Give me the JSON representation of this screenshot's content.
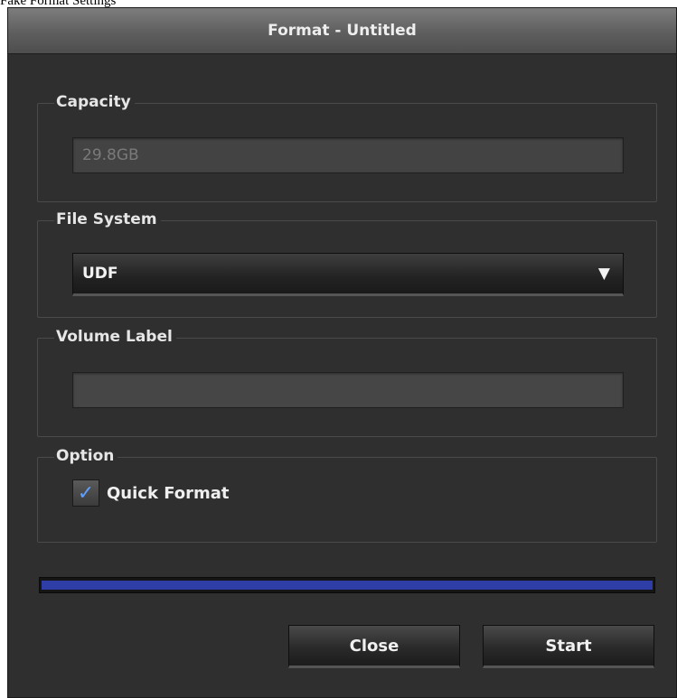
{
  "caption": "Fake Format Settings",
  "window": {
    "title": "Format - Untitled"
  },
  "capacity": {
    "legend": "Capacity",
    "value": "29.8GB"
  },
  "file_system": {
    "legend": "File System",
    "selected": "UDF",
    "arrow_icon": "▼"
  },
  "volume_label": {
    "legend": "Volume Label",
    "value": ""
  },
  "option": {
    "legend": "Option",
    "quick_format_label": "Quick Format",
    "quick_format_checked": true,
    "check_glyph": "✓"
  },
  "progress": {
    "fraction": 1.0,
    "color": "#2f3ea6"
  },
  "buttons": {
    "close": "Close",
    "start": "Start"
  }
}
